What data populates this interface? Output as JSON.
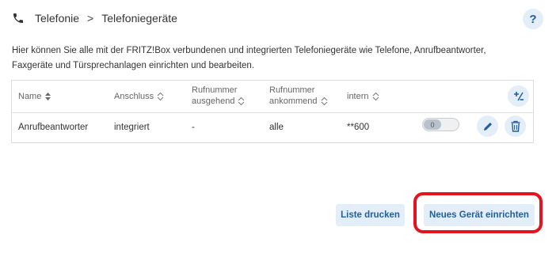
{
  "breadcrumb": {
    "section": "Telefonie",
    "separator": ">",
    "page": "Telefoniegeräte"
  },
  "help": {
    "label": "?"
  },
  "intro_text": "Hier können Sie alle mit der FRITZ!Box verbundenen und integrierten Telefoniegeräte wie Telefone, Anrufbeantworter, Faxgeräte und Türsprechanlagen einrichten und bearbeiten.",
  "table": {
    "headers": {
      "name": "Name",
      "anschluss": "Anschluss",
      "rufnummer_ausgehend_1": "Rufnummer",
      "rufnummer_ausgehend_2": "ausgehend",
      "rufnummer_ankommend_1": "Rufnummer",
      "rufnummer_ankommend_2": "ankommend",
      "intern": "intern"
    },
    "rows": [
      {
        "name": "Anrufbeantworter",
        "anschluss": "integriert",
        "ausgehend": "-",
        "ankommend": "alle",
        "intern": "**600",
        "toggle_label": "0",
        "enabled": false
      }
    ]
  },
  "buttons": {
    "print": "Liste drucken",
    "new_device": "Neues Gerät einrichten"
  },
  "colors": {
    "accent": "#1e5fa8",
    "button_bg": "#e3eef8",
    "highlight": "#e5141c"
  },
  "icons": {
    "header": "phone-icon",
    "column_toggle": "column-settings-icon",
    "edit": "pencil-icon",
    "delete": "trash-icon",
    "sort": "sort-icon"
  }
}
